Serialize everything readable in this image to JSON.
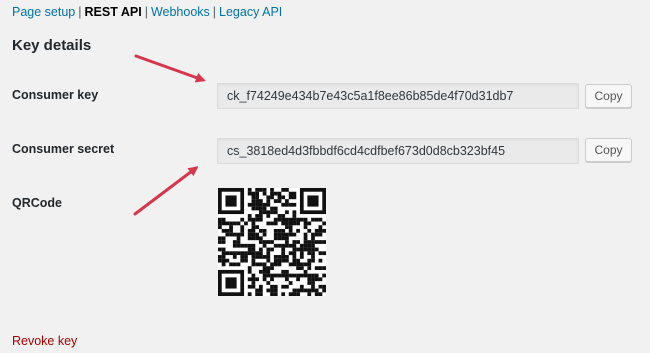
{
  "subnav": {
    "items": [
      {
        "label": "Page setup",
        "current": false
      },
      {
        "label": "REST API",
        "current": true
      },
      {
        "label": "Webhooks",
        "current": false
      },
      {
        "label": "Legacy API",
        "current": false
      }
    ],
    "separator": "|"
  },
  "section_title": "Key details",
  "consumer_key": {
    "label": "Consumer key",
    "value": "ck_f74249e434b7e43c5a1f8ee86b85de4f70d31db7",
    "copy_label": "Copy"
  },
  "consumer_secret": {
    "label": "Consumer secret",
    "value": "cs_3818ed4d3fbbdf6cd4cdfbef673d0d8cb323bf45",
    "copy_label": "Copy"
  },
  "qrcode": {
    "label": "QRCode"
  },
  "revoke_label": "Revoke key",
  "colors": {
    "link": "#0073aa",
    "revoke": "#aa0000",
    "annotation_arrow": "#d6364e",
    "background": "#f1f1f1"
  }
}
